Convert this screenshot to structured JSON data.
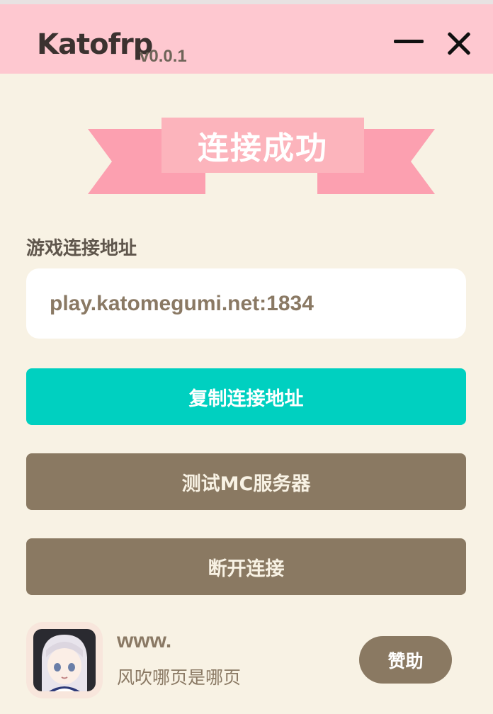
{
  "titlebar": {
    "brand": "Katofrp",
    "version": "v0.0.1",
    "minimize_icon": "minimize-icon",
    "close_icon": "close-icon"
  },
  "status": {
    "banner_text": "连接成功",
    "colors": {
      "banner_main": "#fcb4bc",
      "banner_ribbon": "#fca0b0"
    }
  },
  "connection": {
    "label": "游戏连接地址",
    "address": "play.katomegumi.net:1834"
  },
  "actions": {
    "copy_label": "复制连接地址",
    "test_label": "测试MC服务器",
    "disconnect_label": "断开连接"
  },
  "footer": {
    "site": "www.",
    "subtitle": "风吹哪页是哪页",
    "sponsor_label": "赞助",
    "avatar_icon": "anime-avatar"
  },
  "colors": {
    "titlebar": "#fec8d0",
    "background": "#f8f2e4",
    "accent": "#00d0c0",
    "brown": "#8a7962"
  }
}
